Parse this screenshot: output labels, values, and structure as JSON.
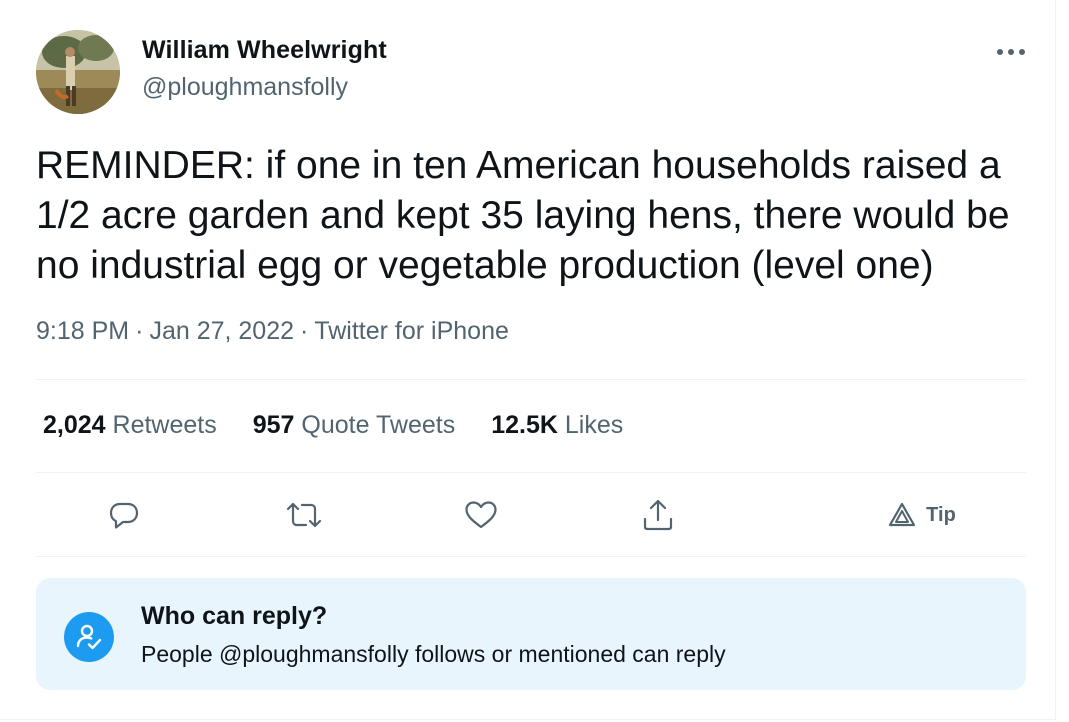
{
  "author": {
    "name": "William Wheelwright",
    "handle": "@ploughmansfolly"
  },
  "tweet": {
    "text": "REMINDER: if one in ten American households raised a 1/2 acre garden and kept 35 laying hens, there would be no industrial egg or vegetable production (level one)",
    "time": "9:18 PM",
    "date": "Jan 27, 2022",
    "source": "Twitter for iPhone",
    "separator": "·"
  },
  "stats": {
    "retweets_count": "2,024",
    "retweets_label": "Retweets",
    "quotes_count": "957",
    "quotes_label": "Quote Tweets",
    "likes_count": "12.5K",
    "likes_label": "Likes"
  },
  "actions": {
    "reply_icon": "reply-icon",
    "retweet_icon": "retweet-icon",
    "like_icon": "heart-icon",
    "share_icon": "share-icon",
    "tip_icon": "tip-icon",
    "tip_label": "Tip"
  },
  "reply_settings": {
    "title": "Who can reply?",
    "description": "People @ploughmansfolly follows or mentioned can reply"
  },
  "colors": {
    "primary_text": "#0f1419",
    "secondary_text": "#536471",
    "accent": "#1d9bf0",
    "reply_box_bg": "#e8f5fd",
    "divider": "#eff3f4"
  }
}
